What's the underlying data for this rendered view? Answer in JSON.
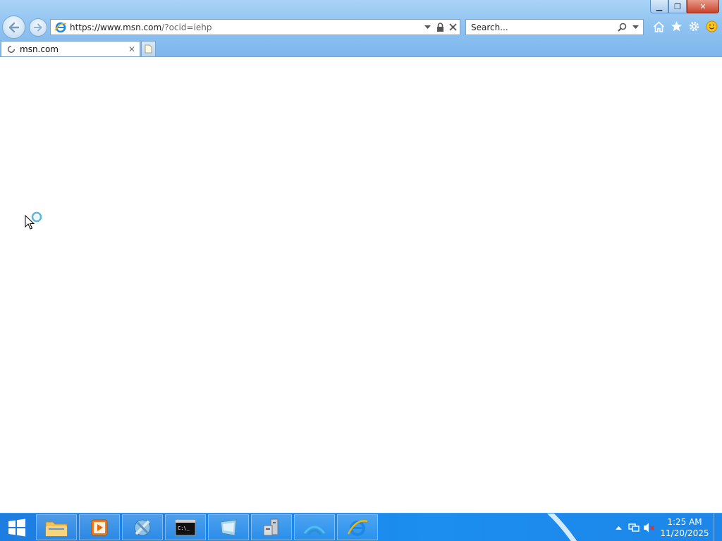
{
  "window": {
    "caption_buttons": [
      {
        "name": "minimize-button",
        "glyph": "▁"
      },
      {
        "name": "restore-button",
        "glyph": "❐"
      },
      {
        "name": "close-button",
        "glyph": "✕"
      }
    ]
  },
  "address_bar": {
    "url_host": "https://www.msn.com",
    "url_rest": "/?ocid=iehp"
  },
  "search_box": {
    "placeholder": "Search..."
  },
  "tab": {
    "title": "msn.com",
    "close_glyph": "✕"
  },
  "taskbar": {
    "pinned": [
      {
        "name": "file-explorer-taskbar-button",
        "icon": "folder-icon"
      },
      {
        "name": "media-player-taskbar-button",
        "icon": "media-player-icon"
      },
      {
        "name": "tools-taskbar-button",
        "icon": "tools-icon"
      },
      {
        "name": "cmd-taskbar-button",
        "icon": "cmd-icon"
      },
      {
        "name": "app-taskbar-button",
        "icon": "app-icon"
      },
      {
        "name": "server-manager-taskbar-button",
        "icon": "server-icon"
      },
      {
        "name": "network-taskbar-button",
        "icon": "network-icon"
      },
      {
        "name": "internet-explorer-taskbar-button",
        "icon": "ie-icon"
      }
    ],
    "clock": {
      "time": "1:25 AM",
      "date": "11/20/2025"
    }
  },
  "colors": {
    "chrome_top": "#a9d3f7",
    "taskbar": "#1b8ef0",
    "ie_blue": "#1e88e5",
    "ie_ring": "#f5b400"
  }
}
